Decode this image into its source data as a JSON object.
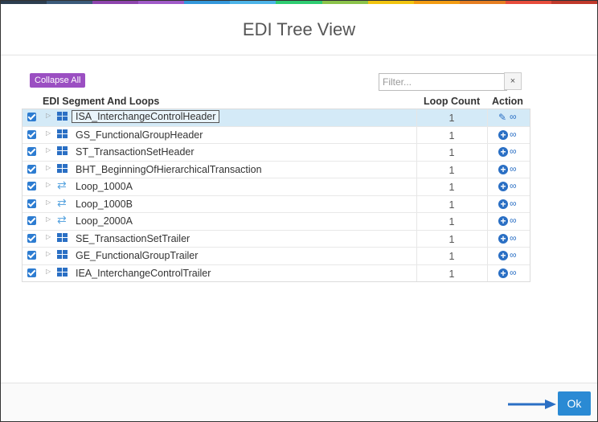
{
  "window": {
    "title": "EDI Tree View",
    "stripe_colors": [
      "#2c3e50",
      "#3b5a7a",
      "#8e44ad",
      "#a05ac8",
      "#3498db",
      "#4cb4e8",
      "#2ecc71",
      "#8bc34a",
      "#f1c40f",
      "#f39c12",
      "#e67e22",
      "#e74c3c",
      "#c0392b"
    ]
  },
  "toolbar": {
    "collapse_label": "Collapse All",
    "filter_placeholder": "Filter...",
    "clear_label": "×"
  },
  "grid": {
    "columns": [
      "EDI Segment And Loops",
      "Loop Count",
      "Action"
    ],
    "rows": [
      {
        "name": "ISA_InterchangeControlHeader",
        "count": "1",
        "type": "segment",
        "checked": true,
        "selected": true,
        "action": "pencil-icon"
      },
      {
        "name": "GS_FunctionalGroupHeader",
        "count": "1",
        "type": "segment",
        "checked": true,
        "selected": false,
        "action": "plus-circle-icon"
      },
      {
        "name": "ST_TransactionSetHeader",
        "count": "1",
        "type": "segment",
        "checked": true,
        "selected": false,
        "action": "plus-circle-icon"
      },
      {
        "name": "BHT_BeginningOfHierarchicalTransaction",
        "count": "1",
        "type": "segment",
        "checked": true,
        "selected": false,
        "action": "plus-circle-icon"
      },
      {
        "name": "Loop_1000A",
        "count": "1",
        "type": "loop",
        "checked": true,
        "selected": false,
        "action": "plus-circle-icon"
      },
      {
        "name": "Loop_1000B",
        "count": "1",
        "type": "loop",
        "checked": true,
        "selected": false,
        "action": "plus-circle-icon"
      },
      {
        "name": "Loop_2000A",
        "count": "1",
        "type": "loop",
        "checked": true,
        "selected": false,
        "action": "plus-circle-icon"
      },
      {
        "name": "SE_TransactionSetTrailer",
        "count": "1",
        "type": "segment",
        "checked": true,
        "selected": false,
        "action": "plus-circle-icon"
      },
      {
        "name": "GE_FunctionalGroupTrailer",
        "count": "1",
        "type": "segment",
        "checked": true,
        "selected": false,
        "action": "plus-circle-icon"
      },
      {
        "name": "IEA_InterchangeControlTrailer",
        "count": "1",
        "type": "segment",
        "checked": true,
        "selected": false,
        "action": "plus-circle-icon"
      }
    ]
  },
  "footer": {
    "ok_label": "Ok",
    "accent": "#2a8ad4"
  }
}
